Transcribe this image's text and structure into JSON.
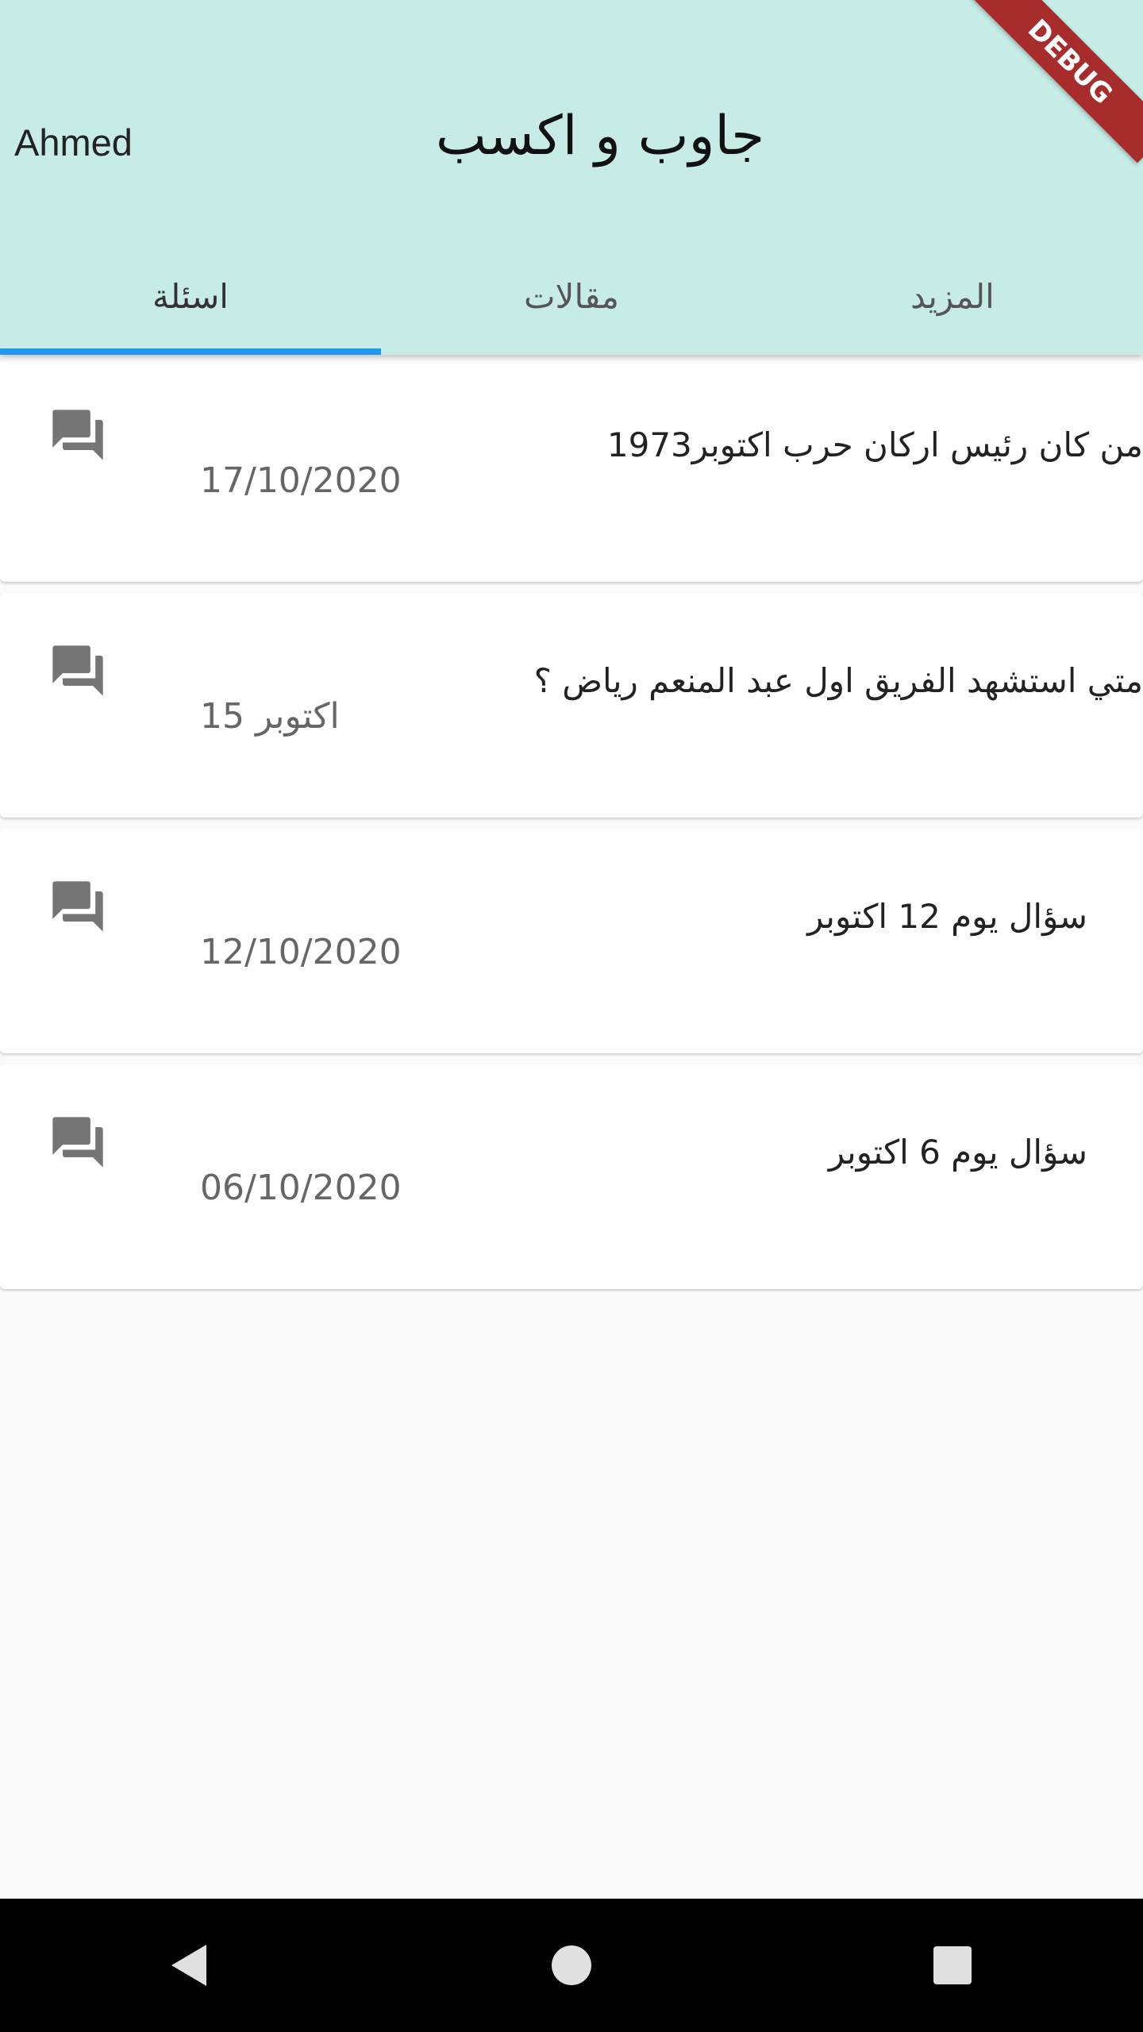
{
  "header": {
    "user_name": "Ahmed",
    "title": "جاوب و اكسب",
    "background_color": "#c7ece6",
    "debug_label": "DEBUG"
  },
  "tabs": [
    {
      "label": "اسئلة",
      "active": true
    },
    {
      "label": "مقالات",
      "active": false
    },
    {
      "label": "المزيد",
      "active": false
    }
  ],
  "accent_color": "#2196f3",
  "questions": [
    {
      "title": "من كان رئيس اركان حرب اكتوبر1973",
      "date": "17/10/2020",
      "icon": "forum-icon"
    },
    {
      "title": "متي استشهد الفريق اول عبد المنعم رياض ؟",
      "date": "15 اكتوبر",
      "icon": "forum-icon"
    },
    {
      "title": "سؤال يوم 12 اكتوبر",
      "date": "12/10/2020",
      "icon": "forum-icon"
    },
    {
      "title": "سؤال يوم 6 اكتوبر",
      "date": "06/10/2020",
      "icon": "forum-icon"
    }
  ],
  "navbar": {
    "back": "back-icon",
    "home": "home-icon",
    "recents": "recents-icon"
  }
}
